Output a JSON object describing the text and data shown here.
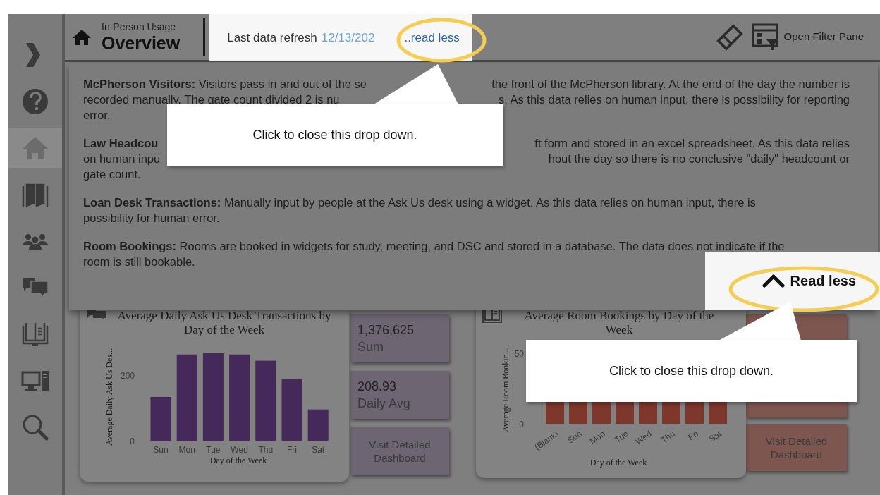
{
  "header": {
    "subtitle": "In-Person Usage",
    "title": "Overview",
    "refresh_label": "Last data refresh",
    "refresh_date": "12/13/202",
    "read_less_link": "..read less",
    "filter_button": "Open Filter Pane"
  },
  "sidebar": {
    "items": [
      {
        "selected": false
      },
      {
        "selected": false
      },
      {
        "selected": true
      },
      {
        "selected": false
      },
      {
        "selected": false
      },
      {
        "selected": false
      },
      {
        "selected": false
      },
      {
        "selected": false
      },
      {
        "selected": false
      }
    ]
  },
  "dropdown": {
    "paragraphs": [
      {
        "lines": [
          [
            "**McPherson Visitors:** Visitors pass in and out of the se",
            "the front of the McPherson library. At the end of the day the number is"
          ],
          [
            "recorded manually. The gate count divided 2 is nu",
            "s. As this data relies on human input, there is possibility for reporting"
          ],
          [
            "error."
          ]
        ]
      },
      {
        "lines": [
          [
            "**Law Headcou**",
            "ft form and stored in an excel spreadsheet. As this data relies"
          ],
          [
            "on human inpu",
            "hout the day so there is no conclusive \"daily\" headcount or"
          ],
          [
            "gate count."
          ]
        ]
      },
      {
        "lines": [
          [
            "**Loan Desk Transactions:** Manually input by people at the Ask Us desk using a widget. As this data relies on human input, there is"
          ],
          [
            "possibility for human error."
          ]
        ]
      },
      {
        "lines": [
          [
            "**Room Bookings:** Rooms are booked in widgets for study, meeting, and DSC and stored in a database. The data does not indicate if the"
          ],
          [
            "room is still bookable."
          ]
        ]
      }
    ],
    "read_less_button": "Read less"
  },
  "desk_chart": {
    "chart_data": {
      "type": "bar",
      "title": "Average Daily Ask Us Desk Transactions by Day of the Week",
      "xlabel": "Day of the Week",
      "ylabel": "Average Daily Ask Us Des...",
      "categories": [
        "Sun",
        "Mon",
        "Tue",
        "Wed",
        "Thu",
        "Fri",
        "Sat"
      ],
      "series": [
        {
          "color": "#44295a",
          "values": [
            133,
            262,
            266,
            262,
            243,
            187,
            95
          ]
        }
      ],
      "ylim": [
        0,
        270
      ],
      "yticks": [
        0,
        200
      ]
    }
  },
  "desk_stats": [
    {
      "value": "1,376,625",
      "label": "Sum"
    },
    {
      "value": "208.93",
      "label": "Daily Avg"
    }
  ],
  "desk_link": "Visit Detailed Dashboard",
  "room_chart": {
    "title": "Average Room Bookings by Day of the Week",
    "ylabel": "Average Room Bookin...",
    "xlabel": "Day of the Week",
    "categories": [
      "(Blank)",
      "Sun",
      "Mon",
      "Tue",
      "Wed",
      "Thu",
      "Fri",
      "Sat"
    ],
    "y_tick_labels": [
      "50",
      "0"
    ]
  },
  "room_link": "Visit Detailed Dashboard",
  "callouts": [
    {
      "text": "Click to close this drop down."
    },
    {
      "text": "Click to close this drop down."
    }
  ]
}
